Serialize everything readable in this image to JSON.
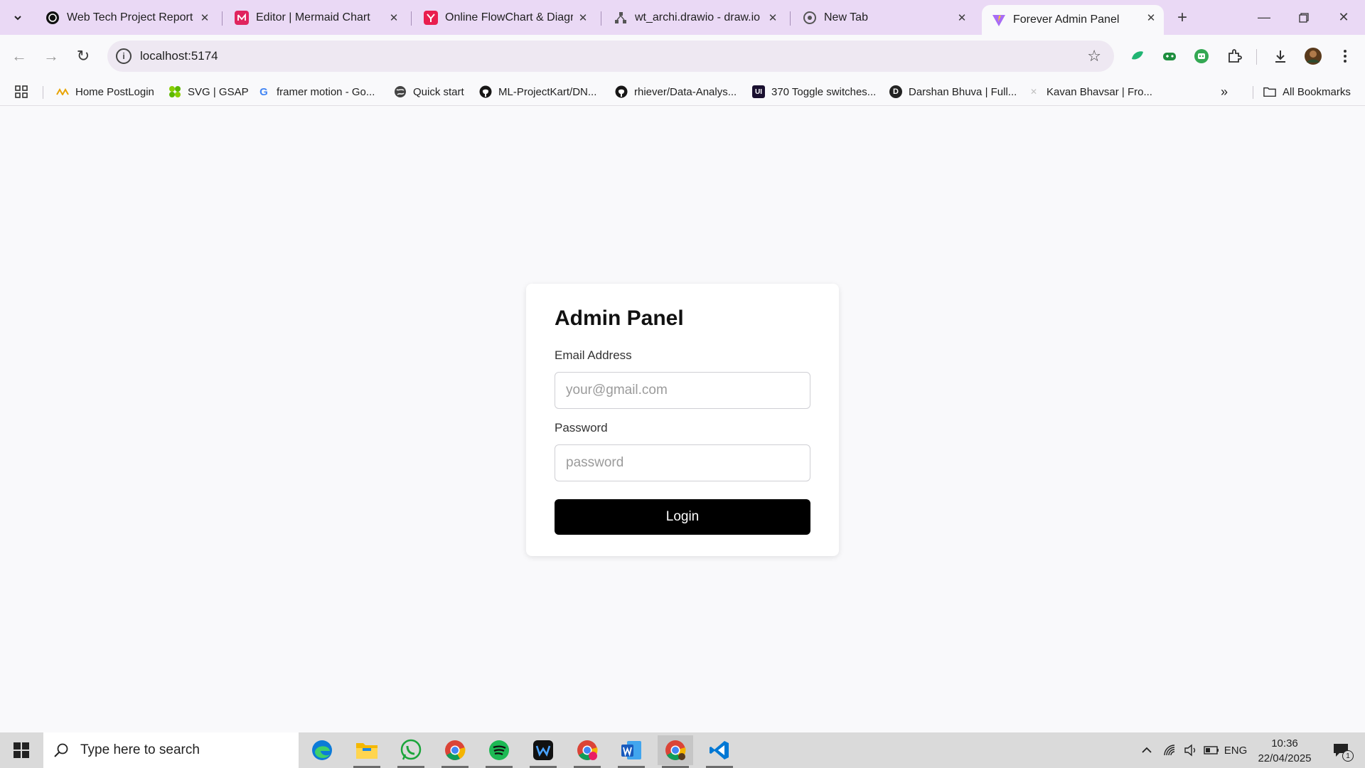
{
  "browser": {
    "tabs": [
      {
        "title": "Web Tech Project Report",
        "icon": "chatgpt-icon"
      },
      {
        "title": "Editor | Mermaid Chart",
        "icon": "mermaid-icon"
      },
      {
        "title": "Online FlowChart & Diagra",
        "icon": "flowchart-icon"
      },
      {
        "title": "wt_archi.drawio - draw.io",
        "icon": "drawio-icon"
      },
      {
        "title": "New Tab",
        "icon": "chrome-icon"
      },
      {
        "title": "Forever Admin Panel",
        "icon": "vite-icon"
      }
    ],
    "active_tab": 5,
    "url": "localhost:5174",
    "bookmarks": [
      "Home PostLogin",
      "SVG | GSAP",
      "framer motion - Go...",
      "Quick start",
      "ML-ProjectKart/DN...",
      "rhiever/Data-Analys...",
      "370 Toggle switches...",
      "Darshan Bhuva | Full...",
      "Kavan Bhavsar | Fro..."
    ],
    "all_bookmarks_label": "All Bookmarks"
  },
  "login": {
    "title": "Admin Panel",
    "email_label": "Email Address",
    "email_placeholder": "your@gmail.com",
    "password_label": "Password",
    "password_placeholder": "password",
    "button_label": "Login"
  },
  "taskbar": {
    "search_placeholder": "Type here to search",
    "language": "ENG",
    "time": "10:36",
    "date": "22/04/2025",
    "notification_count": "1"
  },
  "colors": {
    "tabstrip": "#ead9f5",
    "page_bg": "#f9f9fb",
    "button_bg": "#000000"
  }
}
